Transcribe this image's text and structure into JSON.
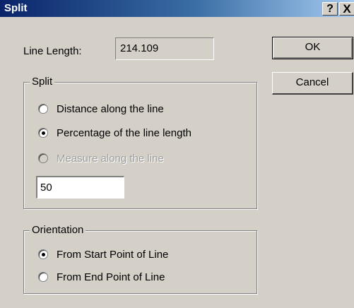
{
  "window": {
    "title": "Split",
    "help_label": "?",
    "close_label": "X"
  },
  "line_length": {
    "label": "Line Length:",
    "value": "214.109"
  },
  "buttons": {
    "ok": "OK",
    "cancel": "Cancel"
  },
  "split_group": {
    "title": "Split",
    "options": [
      {
        "label": "Distance along the line",
        "selected": false,
        "enabled": true
      },
      {
        "label": "Percentage of the line length",
        "selected": true,
        "enabled": true
      },
      {
        "label": "Measure along the line",
        "selected": false,
        "enabled": false
      }
    ],
    "input_value": "50"
  },
  "orientation_group": {
    "title": "Orientation",
    "options": [
      {
        "label": "From Start Point of Line",
        "selected": true
      },
      {
        "label": "From End Point of Line",
        "selected": false
      }
    ]
  },
  "colors": {
    "dialog_bg": "#d4d0c8",
    "titlebar_start": "#0a246a",
    "titlebar_end": "#a6caf0"
  }
}
